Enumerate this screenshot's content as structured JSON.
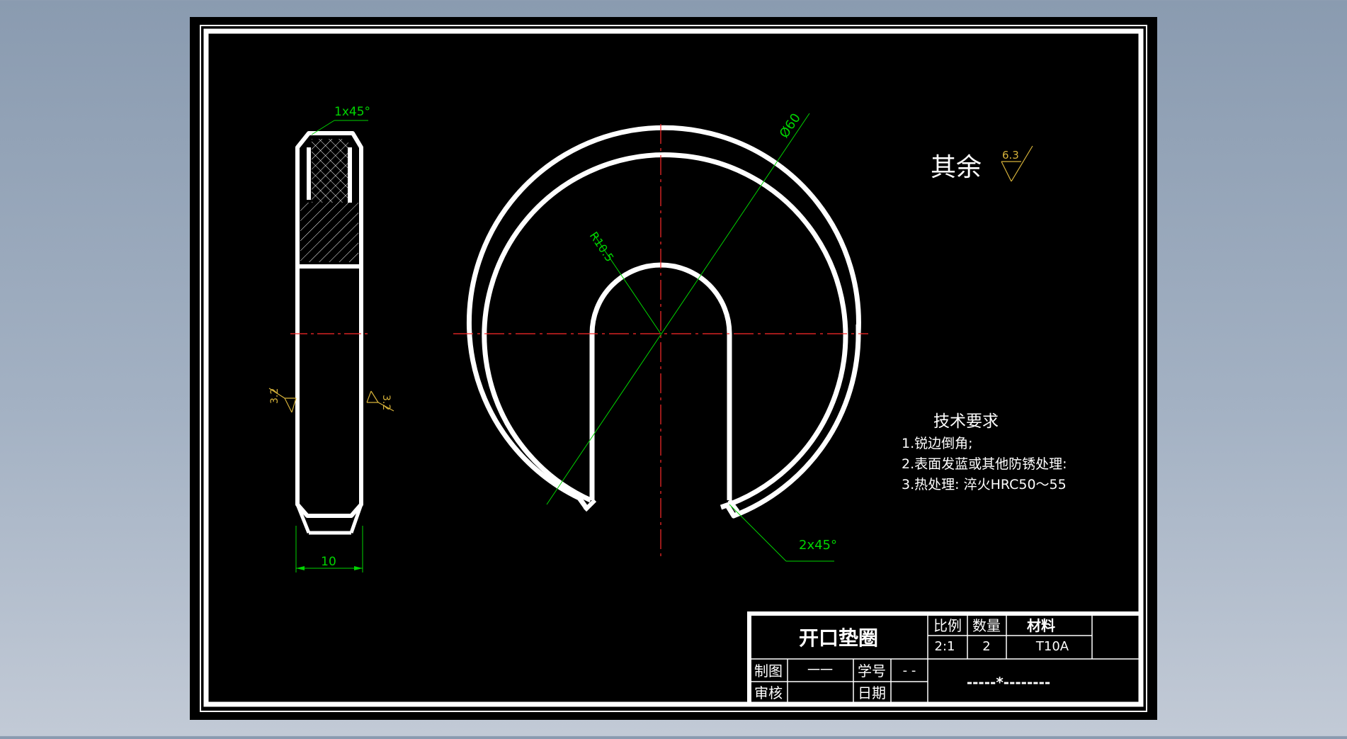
{
  "colors": {
    "background_top": "#8a9bb0",
    "paper": "#000000",
    "outline": "#ffffff",
    "center_line": "#ff2a2a",
    "dimension": "#00d400",
    "roughness": "#d6b23a"
  },
  "drawing": {
    "dimensions": {
      "chamfer_top": "1x45°",
      "width": "10",
      "diameter": "Ø60",
      "radius": "R10.5",
      "chamfer_slot": "2x45°"
    },
    "roughness": {
      "left": "3.2",
      "right": "3.2",
      "general_value": "6.3",
      "general_label": "其余"
    },
    "tech_requirements": {
      "title": "技术要求",
      "items": [
        "1.锐边倒角;",
        "2.表面发蓝或其他防锈处理:",
        "3.热处理: 淬火HRC50～55"
      ]
    }
  },
  "title_block": {
    "part_name": "开口垫圈",
    "scale_label": "比例",
    "quantity_label": "数量",
    "material_label": "材料",
    "scale_value": "2:1",
    "quantity_value": "2",
    "material_value": "T10A",
    "drawn_by_label": "制图",
    "drawn_by_value": "一一",
    "student_no_label": "学号",
    "student_no_value": "- -",
    "reviewed_label": "审核",
    "date_label": "日期",
    "school_text": "-----*--------"
  }
}
